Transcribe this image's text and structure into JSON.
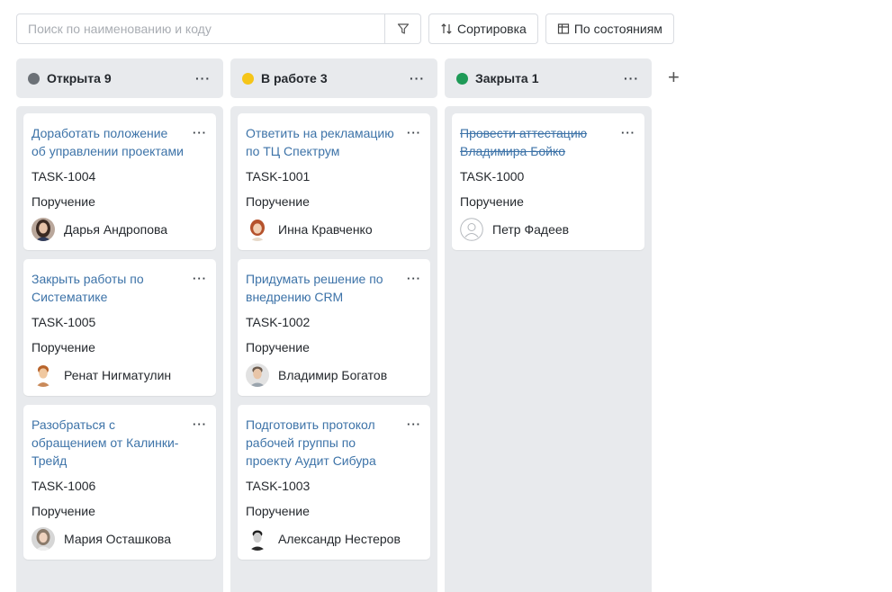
{
  "search": {
    "placeholder": "Поиск по наименованию и коду",
    "value": ""
  },
  "toolbar": {
    "sort_label": "Сортировка",
    "group_label": "По состояниям"
  },
  "add_column_symbol": "+",
  "columns": [
    {
      "title": "Открыта",
      "count": "9",
      "color": "#6c7177",
      "cards": [
        {
          "title": "Доработать положение об управлении проектами",
          "code": "TASK-1004",
          "type": "Поручение",
          "assignee": "Дарья Андропова",
          "avatar": "woman-dark"
        },
        {
          "title": "Закрыть работы по Систематике",
          "code": "TASK-1005",
          "type": "Поручение",
          "assignee": "Ренат Нигматулин",
          "avatar": "man-ginger"
        },
        {
          "title": "Разобраться с обращением от Калинки-Трейд",
          "code": "TASK-1006",
          "type": "Поручение",
          "assignee": "Мария Осташкова",
          "avatar": "woman-light"
        }
      ]
    },
    {
      "title": "В работе",
      "count": "3",
      "color": "#f5c518",
      "cards": [
        {
          "title": "Ответить на рекламацию по ТЦ Спектрум",
          "code": "TASK-1001",
          "type": "Поручение",
          "assignee": "Инна Кравченко",
          "avatar": "woman-red"
        },
        {
          "title": "Придумать решение по внедрению CRM",
          "code": "TASK-1002",
          "type": "Поручение",
          "assignee": "Владимир Богатов",
          "avatar": "man-grey"
        },
        {
          "title": "Подготовить протокол рабочей группы по проекту Аудит Сибура",
          "code": "TASK-1003",
          "type": "Поручение",
          "assignee": "Александр Нестеров",
          "avatar": "man-bw"
        }
      ]
    },
    {
      "title": "Закрыта",
      "count": "1",
      "color": "#1e9a57",
      "cards": [
        {
          "title": "Провести аттестацию Владимира Бойко",
          "code": "TASK-1000",
          "type": "Поручение",
          "assignee": "Петр Фадеев",
          "avatar": "placeholder",
          "closed": true
        }
      ]
    }
  ]
}
